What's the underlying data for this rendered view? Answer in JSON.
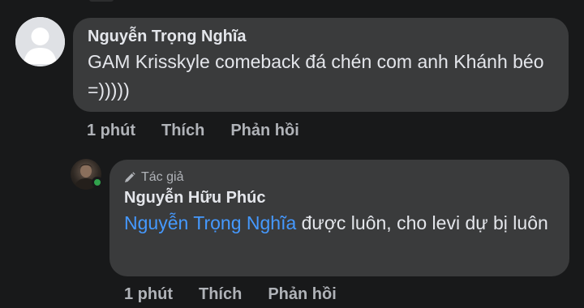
{
  "comments": [
    {
      "author": "Nguyễn Trọng Nghĩa",
      "text": "GAM Krisskyle comeback đá chén com anh Khánh béo =)))))",
      "time": "1 phút",
      "like_label": "Thích",
      "reply_label": "Phản hồi"
    }
  ],
  "reply": {
    "badge_label": "Tác giả",
    "author": "Nguyễn Hữu Phúc",
    "mention": "Nguyễn Trọng Nghĩa",
    "text": " được luôn, cho levi dự bị luôn",
    "time": "1 phút",
    "like_label": "Thích",
    "reply_label": "Phản hồi",
    "online": true
  },
  "colors": {
    "background": "#18191a",
    "bubble": "#3a3b3c",
    "text": "#e4e6eb",
    "secondary": "#b0b3b8",
    "mention": "#4599ff",
    "online": "#31a24c"
  },
  "icons": {
    "default_avatar": "user-silhouette-icon",
    "author_badge": "pencil-icon"
  }
}
